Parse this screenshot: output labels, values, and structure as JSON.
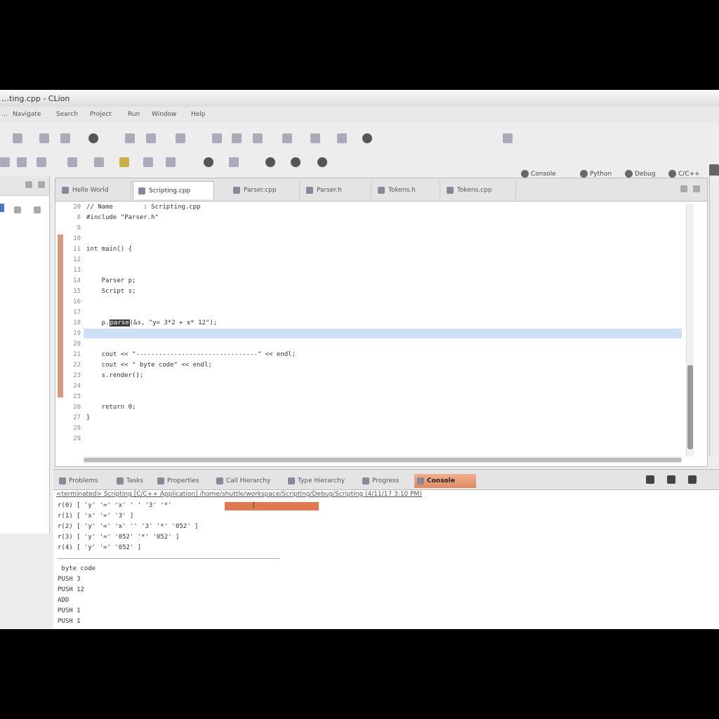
{
  "window": {
    "title": "…ting.cpp - CLion"
  },
  "menu": [
    "…",
    "Navigate",
    "Search",
    "Project",
    "Run",
    "Window",
    "Help"
  ],
  "perspectives": [
    {
      "label": "Console"
    },
    {
      "label": "Python"
    },
    {
      "label": "Debug"
    },
    {
      "label": "C/C++"
    }
  ],
  "editor": {
    "tabs": [
      {
        "label": "Hello World",
        "active": false
      },
      {
        "label": "Scripting.cpp",
        "active": true
      },
      {
        "label": "Parser.cpp",
        "active": false
      },
      {
        "label": "Parser.h",
        "active": false
      },
      {
        "label": "Tokens.h",
        "active": false
      },
      {
        "label": "Tokens.cpp",
        "active": false
      }
    ],
    "lines": [
      {
        "n": "20",
        "text": "// Name        : Scripting.cpp"
      },
      {
        "n": "8",
        "text": "#include \"Parser.h\""
      },
      {
        "n": "9",
        "text": ""
      },
      {
        "n": "10",
        "text": ""
      },
      {
        "n": "11",
        "text": "int main() {"
      },
      {
        "n": "12",
        "text": ""
      },
      {
        "n": "13",
        "text": ""
      },
      {
        "n": "14",
        "text": "    Parser p;"
      },
      {
        "n": "15",
        "text": "    Script s;"
      },
      {
        "n": "16",
        "text": ""
      },
      {
        "n": "17",
        "text": ""
      },
      {
        "n": "18",
        "text": "    p.",
        "highlight": "parse",
        "rest": "(&s, \"y= 3*2 + x* 12\");"
      },
      {
        "n": "19",
        "text": ""
      },
      {
        "n": "20",
        "text": ""
      },
      {
        "n": "21",
        "text": "    cout << \"--------------------------------\" << endl;"
      },
      {
        "n": "22",
        "text": "    cout << \" byte code\" << endl;"
      },
      {
        "n": "23",
        "text": "    s.render();"
      },
      {
        "n": "24",
        "text": ""
      },
      {
        "n": "25",
        "text": ""
      },
      {
        "n": "26",
        "text": "    return 0;"
      },
      {
        "n": "27",
        "text": "}"
      },
      {
        "n": "28",
        "text": ""
      },
      {
        "n": "29",
        "text": ""
      }
    ]
  },
  "console": {
    "tabs": [
      {
        "label": "Problems"
      },
      {
        "label": "Tasks"
      },
      {
        "label": "Properties"
      },
      {
        "label": "Call Hierarchy"
      },
      {
        "label": "Type Hierarchy"
      },
      {
        "label": "Progress"
      },
      {
        "label": "Console",
        "active": true
      }
    ],
    "info": "<terminated> Scripting [C/C++ Application] /home/shuttle/workspace/Scripting/Debug/Scripting (4/11/17 3:10 PM)",
    "lines": [
      "r(0) [ 'y' '=' 'x' ' ' '3' '*'                     ]",
      "r(1) [ 'x' '=' '3' ]",
      "r(2) [ 'y' '=' 'x' '' '3' '*' '052' ]",
      "r(3) [ 'y' '=' '052' '*' '052' ]",
      "r(4) [ 'y' '=' '052' ]",
      "",
      " byte code",
      "PUSH 3",
      "PUSH 12",
      "ADD",
      "PUSH 1",
      "PUSH 1"
    ]
  }
}
